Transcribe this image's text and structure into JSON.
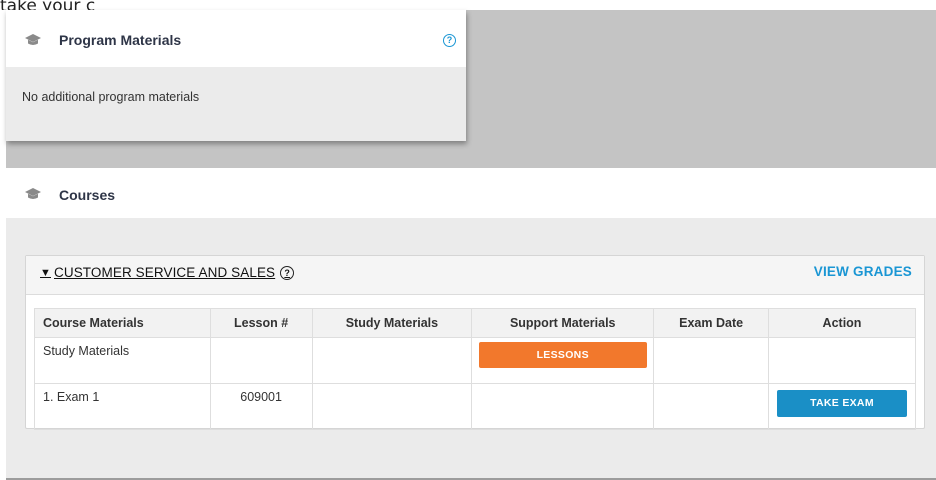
{
  "top_fragment": "take your c",
  "program_materials": {
    "title": "Program Materials",
    "help": "?",
    "body_text": "No additional program materials"
  },
  "courses": {
    "title": "Courses",
    "course": {
      "name": "CUSTOMER SERVICE AND SALES",
      "toggle": "▼",
      "help": "?",
      "view_grades_label": "VIEW GRADES",
      "columns": [
        "Course Materials",
        "Lesson #",
        "Study Materials",
        "Support Materials",
        "Exam Date",
        "Action"
      ],
      "rows": [
        {
          "course_material": "Study Materials",
          "lesson": "",
          "study_materials": "",
          "support_button": "LESSONS",
          "exam_date": "",
          "action": ""
        },
        {
          "course_material": "1. Exam 1",
          "lesson": "609001",
          "study_materials": "",
          "support_button": "",
          "exam_date": "",
          "action": "TAKE EXAM"
        }
      ]
    }
  },
  "colors": {
    "accent_blue": "#1a96d4",
    "lessons_orange": "#f2782c",
    "exam_button_blue": "#1a8fc6",
    "frame_gray": "#c4c4c4",
    "panel_gray": "#ebebeb"
  },
  "icons": {
    "section_icon": "graduation-cap-icon",
    "help_icon": "question-circle-icon"
  }
}
